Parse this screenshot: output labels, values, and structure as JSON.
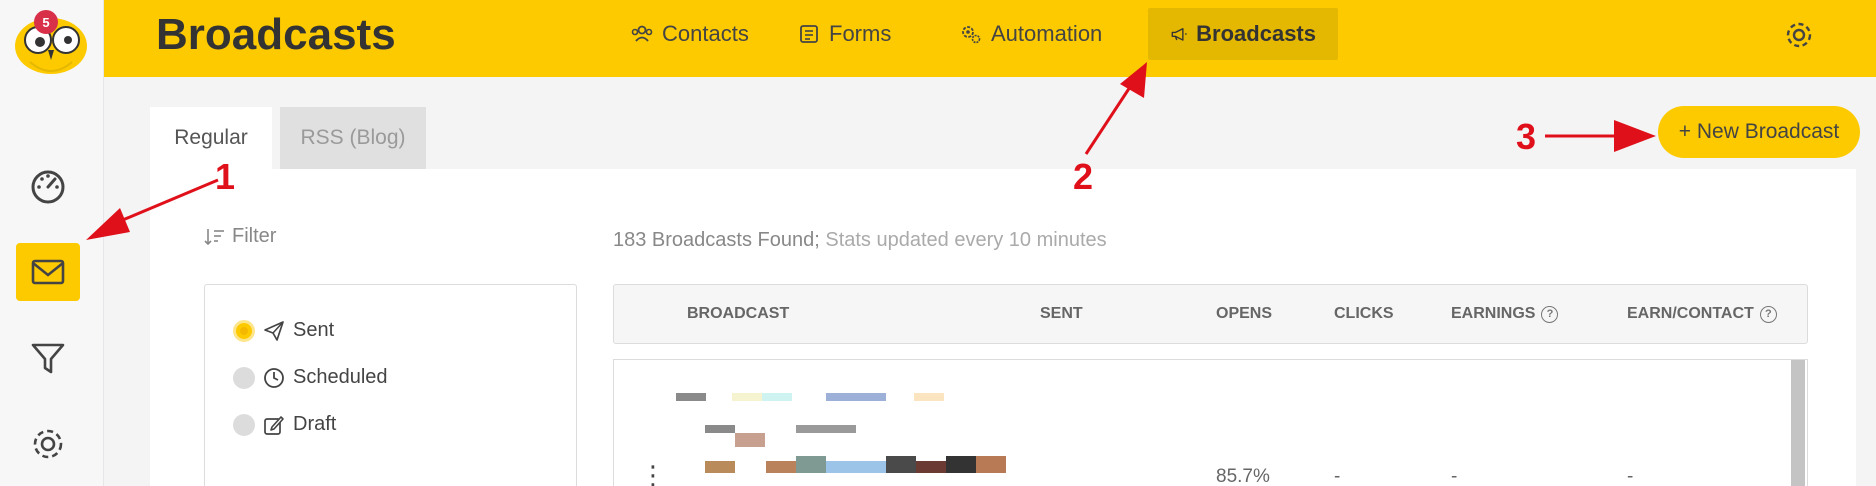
{
  "app": {
    "notification_count": "5",
    "page_title": "Broadcasts"
  },
  "nav": {
    "items": [
      {
        "label": "Contacts",
        "icon": "users-icon"
      },
      {
        "label": "Forms",
        "icon": "form-icon"
      },
      {
        "label": "Automation",
        "icon": "gears-icon"
      },
      {
        "label": "Broadcasts",
        "icon": "megaphone-icon",
        "active": true
      }
    ]
  },
  "sidebar": {
    "items": [
      {
        "name": "dashboard",
        "icon": "speedometer-icon"
      },
      {
        "name": "broadcasts",
        "icon": "envelope-icon",
        "active": true
      },
      {
        "name": "funnels",
        "icon": "filter-icon"
      },
      {
        "name": "settings",
        "icon": "gear-icon"
      }
    ]
  },
  "tabs": [
    {
      "label": "Regular",
      "active": true
    },
    {
      "label": "RSS (Blog)",
      "active": false
    }
  ],
  "new_broadcast_label": "+ New Broadcast",
  "filter": {
    "label": "Filter",
    "options": [
      {
        "label": "Sent",
        "selected": true
      },
      {
        "label": "Scheduled",
        "selected": false
      },
      {
        "label": "Draft",
        "selected": false
      }
    ]
  },
  "summary": {
    "count_text": "183 Broadcasts Found;",
    "stats_text": " Stats updated every 10 minutes"
  },
  "table": {
    "headers": [
      "BROADCAST",
      "SENT",
      "OPENS",
      "CLICKS",
      "EARNINGS",
      "EARN/CONTACT"
    ],
    "rows": [
      {
        "opens": "85.7%",
        "clicks": "-",
        "earnings": "-",
        "earn_contact": "-"
      }
    ]
  },
  "annotations": [
    "1",
    "2",
    "3"
  ],
  "colors": {
    "accent": "#fdca00",
    "annotation": "#e0101a"
  }
}
